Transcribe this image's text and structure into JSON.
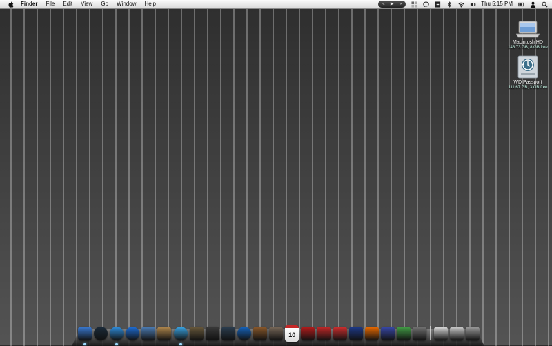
{
  "menubar": {
    "app_name": "Finder",
    "menus": [
      "File",
      "Edit",
      "View",
      "Go",
      "Window",
      "Help"
    ],
    "media_controls": [
      "«",
      "▶",
      "»"
    ],
    "clock": "Thu 5:15 PM"
  },
  "desktop": {
    "icons": [
      {
        "name": "Macintosh HD",
        "sub": "148.73 GB, 8 GB free"
      },
      {
        "name": "WD Passport",
        "sub": "111.67 GB, 3 GB free"
      }
    ]
  },
  "dock": {
    "calendar_day": "10",
    "items": [
      {
        "icon": "finder-icon",
        "color": "#3a7bd5",
        "running": true
      },
      {
        "icon": "time-machine-dock-icon",
        "color": "#1b2b3a",
        "running": false
      },
      {
        "icon": "safari-icon",
        "color": "#2f8fe0",
        "running": true
      },
      {
        "icon": "ichat-icon",
        "color": "#1e6fd9",
        "running": false
      },
      {
        "icon": "preview-icon",
        "color": "#4d7fb8",
        "running": false
      },
      {
        "icon": "address-book-icon",
        "color": "#b48a4e",
        "running": false
      },
      {
        "icon": "itunes-icon",
        "color": "#3aa7e8",
        "running": true
      },
      {
        "icon": "iphoto-icon",
        "color": "#6a5a3c",
        "running": false
      },
      {
        "icon": "utility-icon",
        "color": "#3a3a3a",
        "running": false
      },
      {
        "icon": "imovie-icon",
        "color": "#2c3e50",
        "running": false
      },
      {
        "icon": "idvd-icon",
        "color": "#1565c0",
        "running": false
      },
      {
        "icon": "garageband-icon",
        "color": "#8d5a2b",
        "running": false
      },
      {
        "icon": "photo-booth-icon",
        "color": "#7a6a5a",
        "running": false
      },
      {
        "icon": "ical-icon",
        "color": "#e8e8e8",
        "running": false
      },
      {
        "icon": "front-row-icon",
        "color": "#b71c1c",
        "running": false
      },
      {
        "icon": "dvd-player-icon",
        "color": "#c62828",
        "running": false
      },
      {
        "icon": "redundant-app-icon",
        "color": "#d32f2f",
        "running": false
      },
      {
        "icon": "transmit-icon",
        "color": "#1e3a8a",
        "running": false
      },
      {
        "icon": "podcast-icon",
        "color": "#ef6c00",
        "running": false
      },
      {
        "icon": "pencil-app-icon",
        "color": "#3949ab",
        "running": false
      },
      {
        "icon": "chart-app-icon",
        "color": "#43a047",
        "running": false
      },
      {
        "icon": "system-preferences-icon",
        "color": "#757575",
        "running": false
      }
    ],
    "right_items": [
      {
        "icon": "document-icon",
        "color": "#e0e0e0"
      },
      {
        "icon": "applications-folder-icon",
        "color": "#d0d0d0"
      },
      {
        "icon": "trash-icon",
        "color": "#9e9e9e"
      }
    ]
  }
}
